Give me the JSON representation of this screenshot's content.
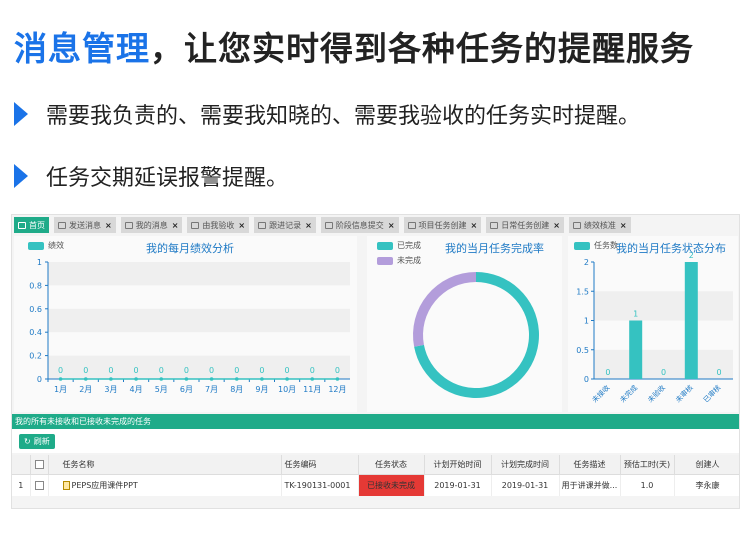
{
  "headline": {
    "highlight": "消息管理",
    "rest": "，让您实时得到各种任务的提醒服务"
  },
  "bullets": [
    "需要我负责的、需要我知晓的、需要我验收的任务实时提醒。",
    "任务交期延误报警提醒。"
  ],
  "tabs": [
    {
      "label": "首页",
      "active": true,
      "closable": false
    },
    {
      "label": "发送消息",
      "closable": true
    },
    {
      "label": "我的消息",
      "closable": true
    },
    {
      "label": "由我验收",
      "closable": true
    },
    {
      "label": "跟进记录",
      "closable": true
    },
    {
      "label": "阶段信息提交",
      "closable": true
    },
    {
      "label": "项目任务创建",
      "closable": true
    },
    {
      "label": "日常任务创建",
      "closable": true
    },
    {
      "label": "绩效核准",
      "closable": true
    }
  ],
  "colors": {
    "accent": "#1fab89",
    "teal": "#35c2c1",
    "lavender": "#b39ddb",
    "title_blue": "#1f7ac5",
    "status_red": "#e53935",
    "headline_blue": "#1a73e8"
  },
  "chart_data": [
    {
      "type": "line",
      "title": "我的每月绩效分析",
      "legend": [
        "绩效"
      ],
      "categories": [
        "1月",
        "2月",
        "3月",
        "4月",
        "5月",
        "6月",
        "7月",
        "8月",
        "9月",
        "10月",
        "11月",
        "12月"
      ],
      "series": [
        {
          "name": "绩效",
          "values": [
            0,
            0,
            0,
            0,
            0,
            0,
            0,
            0,
            0,
            0,
            0,
            0
          ]
        }
      ],
      "ylim": [
        0,
        1
      ],
      "yticks": [
        "0",
        "0.2",
        "0.4",
        "0.6",
        "0.8",
        "1"
      ]
    },
    {
      "type": "pie",
      "title": "我的当月任务完成率",
      "legend": [
        "已完成",
        "未完成"
      ],
      "slices": [
        {
          "name": "已完成",
          "value": 0.72
        },
        {
          "name": "未完成",
          "value": 0.28
        }
      ]
    },
    {
      "type": "bar",
      "title": "我的当月任务状态分布",
      "legend": [
        "任务数"
      ],
      "categories": [
        "未接收",
        "未完成",
        "未验收",
        "未审核",
        "已审核"
      ],
      "series": [
        {
          "name": "任务数",
          "values": [
            0,
            1,
            0,
            2,
            0
          ]
        }
      ],
      "ylim": [
        0,
        2
      ],
      "yticks": [
        "0",
        "0.5",
        "1",
        "1.5",
        "2"
      ]
    }
  ],
  "grid": {
    "title": "我的所有未接收和已接收未完成的任务",
    "refresh_label": "刷新",
    "columns": [
      "",
      "",
      "任务名称",
      "任务编码",
      "任务状态",
      "计划开始时间",
      "计划完成时间",
      "任务描述",
      "预估工时(天)",
      "创建人"
    ],
    "rows": [
      {
        "index": "1",
        "name": "PEPS应用课件PPT",
        "code": "TK-190131-0001",
        "status": "已接收未完成",
        "start": "2019-01-31",
        "end": "2019-01-31",
        "desc": "用于讲课并做...",
        "hours": "1.0",
        "creator": "李永康"
      }
    ]
  }
}
